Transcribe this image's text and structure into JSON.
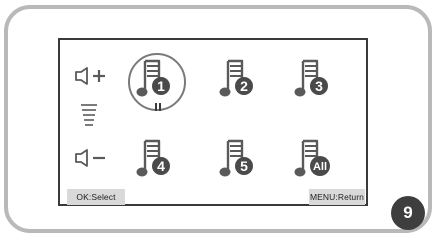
{
  "screen": {
    "tracks": [
      {
        "number": "1",
        "selected": true,
        "status": "pause"
      },
      {
        "number": "2"
      },
      {
        "number": "3"
      },
      {
        "number": "4"
      },
      {
        "number": "5"
      },
      {
        "number": "All"
      }
    ],
    "softkeys": {
      "left_label": "OK:Select",
      "right_label": "MENU:Return"
    },
    "volume": {
      "up_icon": "speaker-plus-icon",
      "level_icon": "volume-level-icon",
      "down_icon": "speaker-minus-icon"
    }
  },
  "figure_badge": "9",
  "colors": {
    "icon": "#5a5a5a",
    "badge_bg": "#4a4a4a",
    "frame": "#b9b9b9",
    "softkey_bg": "#d9d9d9"
  }
}
